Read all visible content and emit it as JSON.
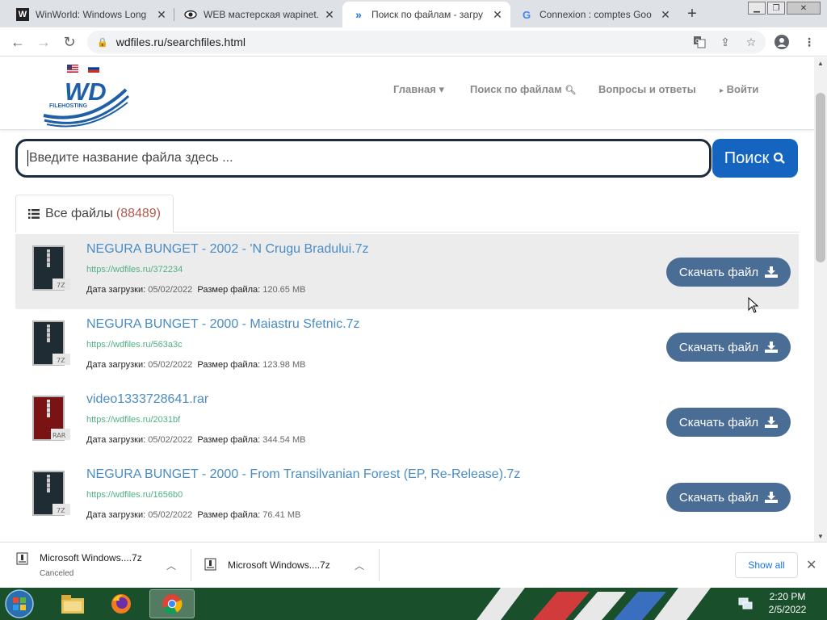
{
  "browser": {
    "tabs": [
      {
        "title": "WinWorld: Windows Long",
        "favicon": "W",
        "active": false
      },
      {
        "title": "WEB мастерская wapinet.",
        "favicon": "eye",
        "active": false
      },
      {
        "title": "Поиск по файлам - загру",
        "favicon": "chevrons",
        "active": true
      },
      {
        "title": "Connexion : comptes Goo",
        "favicon": "G",
        "active": false
      }
    ],
    "url": "wdfiles.ru/searchfiles.html"
  },
  "site": {
    "logo_text": "WD",
    "logo_sub": "FILEHOSTING",
    "nav": [
      {
        "label": "Главная",
        "icon": "caret-down"
      },
      {
        "label": "Поиск по файлам",
        "icon": "search"
      },
      {
        "label": "Вопросы и ответы",
        "icon": ""
      },
      {
        "label": "Войти",
        "icon": "caret-right"
      }
    ],
    "search": {
      "placeholder": "Введите название файла здесь ...",
      "button_label": "Поиск"
    },
    "files_tab": {
      "label": "Все файлы",
      "count": "(88489)"
    },
    "download_label": "Скачать файл",
    "date_label": "Дата загрузки",
    "size_label": "Размер файла",
    "files": [
      {
        "name": "NEGURA BUNGET - 2002 - 'N Crugu Bradului.7z",
        "link": "https://wdfiles.ru/372234",
        "date": "05/02/2022",
        "size": "120.65 MB",
        "ext": "7Z"
      },
      {
        "name": "NEGURA BUNGET - 2000 - Maiastru Sfetnic.7z",
        "link": "https://wdfiles.ru/563a3c",
        "date": "05/02/2022",
        "size": "123.98 MB",
        "ext": "7Z"
      },
      {
        "name": "video1333728641.rar",
        "link": "https://wdfiles.ru/2031bf",
        "date": "05/02/2022",
        "size": "344.54 MB",
        "ext": "RAR"
      },
      {
        "name": "NEGURA BUNGET - 2000 - From Transilvanian Forest (EP, Re-Release).7z",
        "link": "https://wdfiles.ru/1656b0",
        "date": "05/02/2022",
        "size": "76.41 MB",
        "ext": "7Z"
      }
    ]
  },
  "downloads": {
    "items": [
      {
        "name": "Microsoft Windows....7z",
        "status": "Canceled"
      },
      {
        "name": "Microsoft Windows....7z",
        "status": ""
      }
    ],
    "show_all": "Show all"
  },
  "taskbar": {
    "time": "2:20 PM",
    "date": "2/5/2022"
  }
}
